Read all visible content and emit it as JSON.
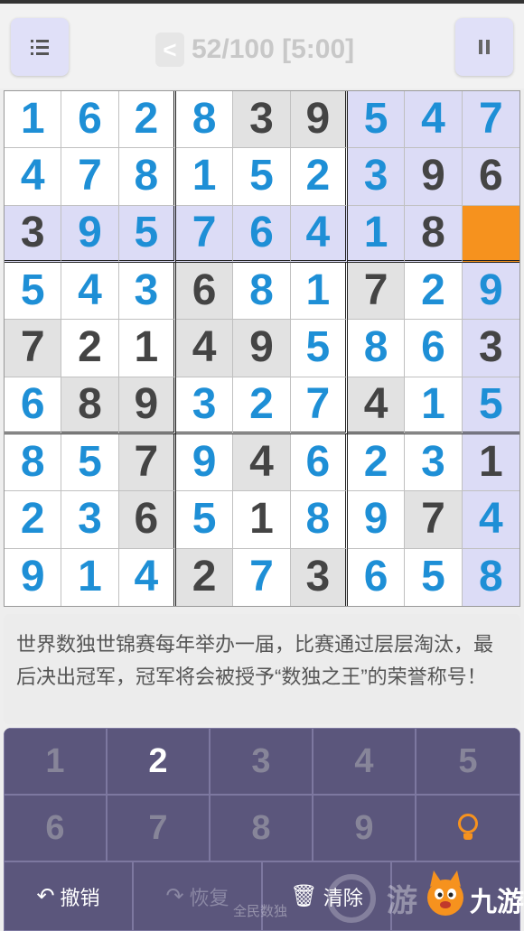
{
  "header": {
    "back_label": "<",
    "progress": "52/100 [5:00]"
  },
  "board": {
    "cells": [
      [
        [
          "1",
          "u",
          "w"
        ],
        [
          "6",
          "u",
          "w"
        ],
        [
          "2",
          "u",
          "w"
        ],
        [
          "8",
          "u",
          "w"
        ],
        [
          "3",
          "g",
          "g"
        ],
        [
          "9",
          "g",
          "g"
        ],
        [
          "5",
          "u",
          "h"
        ],
        [
          "4",
          "u",
          "h"
        ],
        [
          "7",
          "u",
          "h"
        ]
      ],
      [
        [
          "4",
          "u",
          "w"
        ],
        [
          "7",
          "u",
          "w"
        ],
        [
          "8",
          "u",
          "w"
        ],
        [
          "1",
          "u",
          "w"
        ],
        [
          "5",
          "u",
          "w"
        ],
        [
          "2",
          "u",
          "w"
        ],
        [
          "3",
          "u",
          "h"
        ],
        [
          "9",
          "g",
          "h"
        ],
        [
          "6",
          "g",
          "h"
        ]
      ],
      [
        [
          "3",
          "g",
          "h"
        ],
        [
          "9",
          "u",
          "h"
        ],
        [
          "5",
          "u",
          "h"
        ],
        [
          "7",
          "u",
          "h"
        ],
        [
          "6",
          "u",
          "h"
        ],
        [
          "4",
          "u",
          "h"
        ],
        [
          "1",
          "u",
          "h"
        ],
        [
          "8",
          "g",
          "h"
        ],
        [
          "",
          "u",
          "o"
        ]
      ],
      [
        [
          "5",
          "u",
          "w"
        ],
        [
          "4",
          "u",
          "w"
        ],
        [
          "3",
          "u",
          "w"
        ],
        [
          "6",
          "g",
          "g"
        ],
        [
          "8",
          "u",
          "w"
        ],
        [
          "1",
          "u",
          "w"
        ],
        [
          "7",
          "g",
          "g"
        ],
        [
          "2",
          "u",
          "w"
        ],
        [
          "9",
          "u",
          "h"
        ]
      ],
      [
        [
          "7",
          "g",
          "g"
        ],
        [
          "2",
          "g",
          "w"
        ],
        [
          "1",
          "g",
          "w"
        ],
        [
          "4",
          "g",
          "g"
        ],
        [
          "9",
          "g",
          "g"
        ],
        [
          "5",
          "u",
          "w"
        ],
        [
          "8",
          "u",
          "w"
        ],
        [
          "6",
          "u",
          "w"
        ],
        [
          "3",
          "g",
          "h"
        ]
      ],
      [
        [
          "6",
          "u",
          "w"
        ],
        [
          "8",
          "g",
          "g"
        ],
        [
          "9",
          "g",
          "g"
        ],
        [
          "3",
          "u",
          "w"
        ],
        [
          "2",
          "u",
          "w"
        ],
        [
          "7",
          "u",
          "w"
        ],
        [
          "4",
          "g",
          "g"
        ],
        [
          "1",
          "u",
          "w"
        ],
        [
          "5",
          "u",
          "h"
        ]
      ],
      [
        [
          "8",
          "u",
          "w"
        ],
        [
          "5",
          "u",
          "w"
        ],
        [
          "7",
          "g",
          "g"
        ],
        [
          "9",
          "u",
          "w"
        ],
        [
          "4",
          "g",
          "g"
        ],
        [
          "6",
          "u",
          "w"
        ],
        [
          "2",
          "u",
          "w"
        ],
        [
          "3",
          "u",
          "w"
        ],
        [
          "1",
          "g",
          "h"
        ]
      ],
      [
        [
          "2",
          "u",
          "w"
        ],
        [
          "3",
          "u",
          "w"
        ],
        [
          "6",
          "g",
          "g"
        ],
        [
          "5",
          "u",
          "w"
        ],
        [
          "1",
          "g",
          "w"
        ],
        [
          "8",
          "u",
          "w"
        ],
        [
          "9",
          "u",
          "w"
        ],
        [
          "7",
          "g",
          "g"
        ],
        [
          "4",
          "u",
          "h"
        ]
      ],
      [
        [
          "9",
          "u",
          "w"
        ],
        [
          "1",
          "u",
          "w"
        ],
        [
          "4",
          "u",
          "w"
        ],
        [
          "2",
          "g",
          "g"
        ],
        [
          "7",
          "u",
          "w"
        ],
        [
          "3",
          "g",
          "g"
        ],
        [
          "6",
          "u",
          "w"
        ],
        [
          "5",
          "u",
          "w"
        ],
        [
          "8",
          "u",
          "h"
        ]
      ]
    ]
  },
  "tip": {
    "text": "世界数独世锦赛每年举办一届，比赛通过层层淘汰，最后决出冠军，冠军将会被授予“数独之王”的荣誉称号！"
  },
  "keypad": {
    "keys": [
      "1",
      "2",
      "3",
      "4",
      "5",
      "6",
      "7",
      "8",
      "9"
    ],
    "active_key": "2",
    "hint_icon": "lightbulb-icon",
    "undo_label": "撤销",
    "redo_label": "恢复",
    "clear_label": "清除"
  },
  "watermark": {
    "small_text": "全民数独",
    "you_text": "游",
    "brand_text": "九游"
  },
  "colors": {
    "user_digit": "#1e8fd6",
    "given_digit": "#444444",
    "highlight": "#dcdcf6",
    "selected": "#f6921e",
    "keypad_bg": "#5b567c"
  }
}
